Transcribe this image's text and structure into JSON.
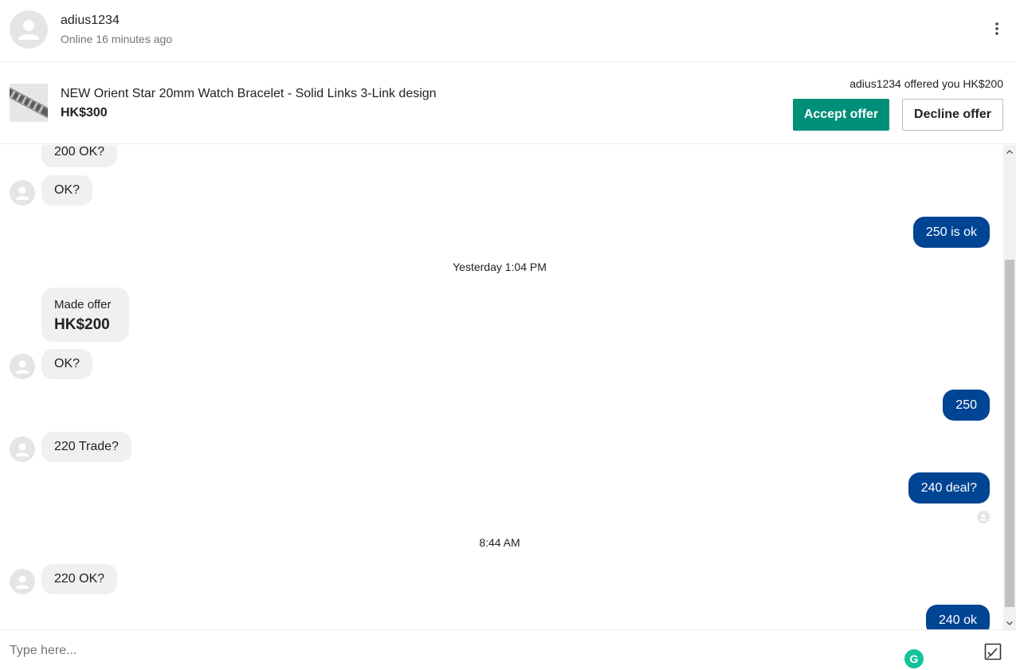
{
  "header": {
    "username": "adius1234",
    "status": "Online 16 minutes ago",
    "more_icon": "more-vertical-icon"
  },
  "offer_bar": {
    "product_title": "NEW Orient Star 20mm Watch Bracelet - Solid Links 3-Link design",
    "product_price": "HK$300",
    "offer_note": "adius1234 offered you HK$200",
    "accept_label": "Accept offer",
    "decline_label": "Decline offer"
  },
  "messages": [
    {
      "direction": "in",
      "text": "200 OK?"
    },
    {
      "direction": "in",
      "text": "OK?"
    },
    {
      "direction": "out",
      "text": "250 is ok"
    },
    {
      "separator": "Yesterday  1:04 PM"
    },
    {
      "direction": "in",
      "offer_label": "Made offer",
      "offer_amount": "HK$200"
    },
    {
      "direction": "in",
      "text": "OK?"
    },
    {
      "direction": "out",
      "text": "250"
    },
    {
      "direction": "in",
      "text": "220 Trade?"
    },
    {
      "direction": "out",
      "text": "240 deal?"
    },
    {
      "separator": "8:44 AM"
    },
    {
      "direction": "in",
      "text": "220 OK?"
    },
    {
      "direction": "out",
      "text": "240 ok"
    }
  ],
  "composer": {
    "placeholder": "Type here...",
    "grammarly_letter": "G",
    "attach_icon": "image-upload-icon"
  },
  "colors": {
    "accent_green": "#008f79",
    "outgoing_bubble": "#004494",
    "incoming_bubble": "#f0f0f0"
  }
}
